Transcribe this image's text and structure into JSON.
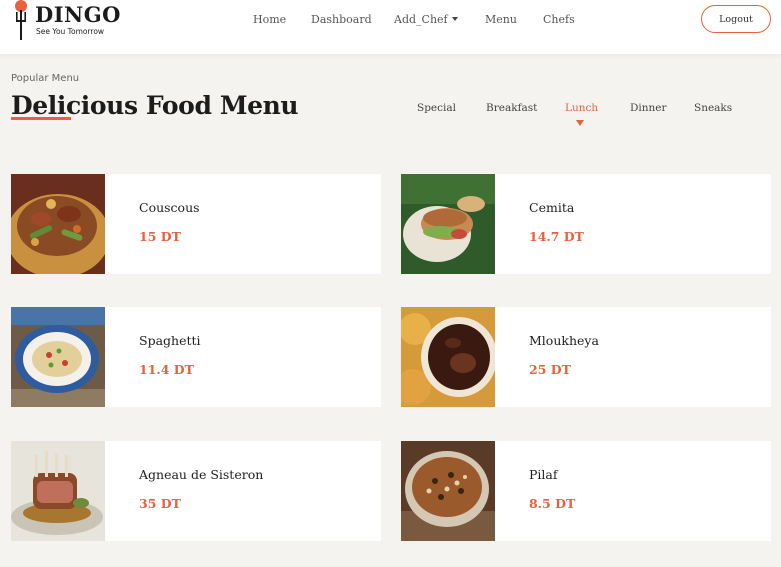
{
  "brand": {
    "name": "DINGO",
    "tagline": "See You Tomorrow",
    "accent": "#e8603c"
  },
  "nav": {
    "home": "Home",
    "dashboard": "Dashboard",
    "add_chef": "Add_Chef",
    "menu": "Menu",
    "chefs": "Chefs",
    "logout": "Logout"
  },
  "section": {
    "eyebrow": "Popular Menu",
    "title": "Delicious Food Menu"
  },
  "tabs": [
    {
      "label": "Special",
      "active": false
    },
    {
      "label": "Breakfast",
      "active": false
    },
    {
      "label": "Lunch",
      "active": true
    },
    {
      "label": "Dinner",
      "active": false
    },
    {
      "label": "Sneaks",
      "active": false
    }
  ],
  "dishes": [
    {
      "name": "Couscous",
      "price": "15 DT",
      "image": "couscous-photo"
    },
    {
      "name": "Cemita",
      "price": "14.7 DT",
      "image": "cemita-photo"
    },
    {
      "name": "Spaghetti",
      "price": "11.4 DT",
      "image": "spaghetti-photo"
    },
    {
      "name": "Mloukheya",
      "price": "25 DT",
      "image": "mloukheya-photo"
    },
    {
      "name": "Agneau de Sisteron",
      "price": "35 DT",
      "image": "lamb-photo"
    },
    {
      "name": "Pilaf",
      "price": "8.5 DT",
      "image": "pilaf-photo"
    }
  ]
}
